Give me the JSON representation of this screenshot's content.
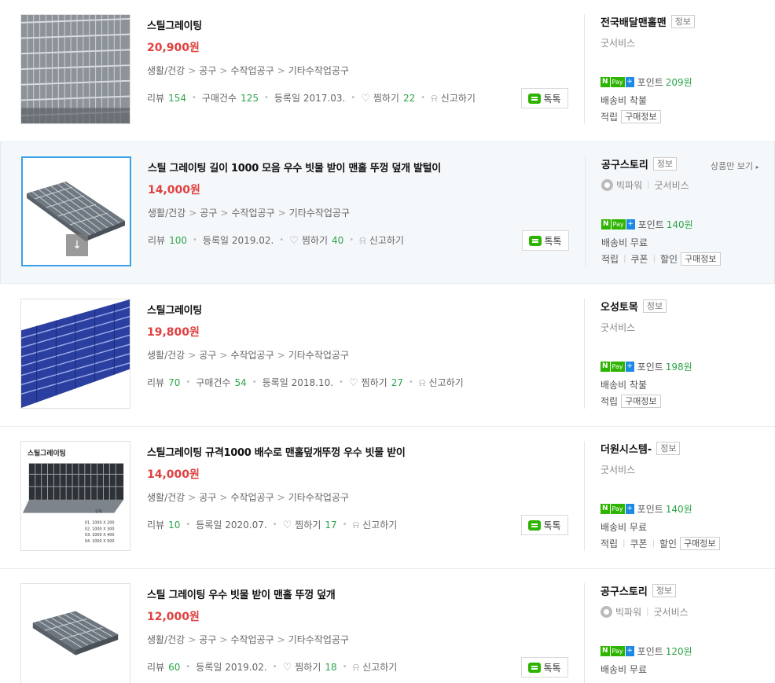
{
  "common": {
    "categories": [
      "생활/건강",
      "공구",
      "수작업공구",
      "기타수작업공구"
    ],
    "review_label": "리뷰",
    "purchase_label": "구매건수",
    "date_label": "등록일",
    "wish_label": "찜하기",
    "report_label": "신고하기",
    "talk_label": "톡톡",
    "info_label": "정보",
    "point_label": "포인트",
    "npay_n": "N",
    "npay_pay": "Pay",
    "npay_plus": "+",
    "accum_label": "적립",
    "purchase_info_label": "구매정보",
    "coupon_label": "쿠폰",
    "discount_label": "할인",
    "goodservice_label": "굿서비스",
    "bigpower_label": "빅파워",
    "more_products_label": "상품만 보기",
    "download_icon": "↓",
    "heart_icon": "♡",
    "bell_icon": "⍾"
  },
  "items": [
    {
      "title": "스틸그레이팅",
      "price": "20,900원",
      "reviews": "154",
      "purchases": "125",
      "date": "2017.03.",
      "wishes": "22",
      "seller": "전국배달맨홀맨",
      "points": "209원",
      "shipping": "배송비 착불"
    },
    {
      "title": "스틸 그레이팅 길이 1000 모음 우수 빗물 받이 맨홀 뚜껑 덮개 발털이",
      "price": "14,000원",
      "reviews": "100",
      "date": "2019.02.",
      "wishes": "40",
      "seller": "공구스토리",
      "points": "140원",
      "shipping": "배송비 무료"
    },
    {
      "title": "스틸그레이팅",
      "price": "19,800원",
      "reviews": "70",
      "purchases": "54",
      "date": "2018.10.",
      "wishes": "27",
      "seller": "오성토목",
      "points": "198원",
      "shipping": "배송비 착불"
    },
    {
      "title": "스틸그레이팅 규격1000 배수로 맨홀덮개뚜껑 우수 빗물 받이",
      "price": "14,000원",
      "reviews": "10",
      "date": "2020.07.",
      "wishes": "17",
      "seller": "더원시스템-",
      "points": "140원",
      "shipping": "배송비 무료",
      "thumb_label": "스틸그레이팅",
      "thumb_spec_title": "규격",
      "thumb_specs": [
        "01. 1000 X 200",
        "02. 1000 X 300",
        "03. 1000 X 400",
        "04. 1000 X 500"
      ]
    },
    {
      "title": "스틸 그레이팅 우수 빗물 받이 맨홀 뚜껑 덮개",
      "price": "12,000원",
      "reviews": "60",
      "date": "2019.02.",
      "wishes": "18",
      "seller": "공구스토리",
      "points": "120원",
      "shipping": "배송비 무료"
    }
  ],
  "colors": {
    "price": "#e04040",
    "count": "#2ea44a",
    "npay_green": "#2db400",
    "highlight_bg": "#f5f8fb",
    "selected_border": "#3aa0e6"
  }
}
